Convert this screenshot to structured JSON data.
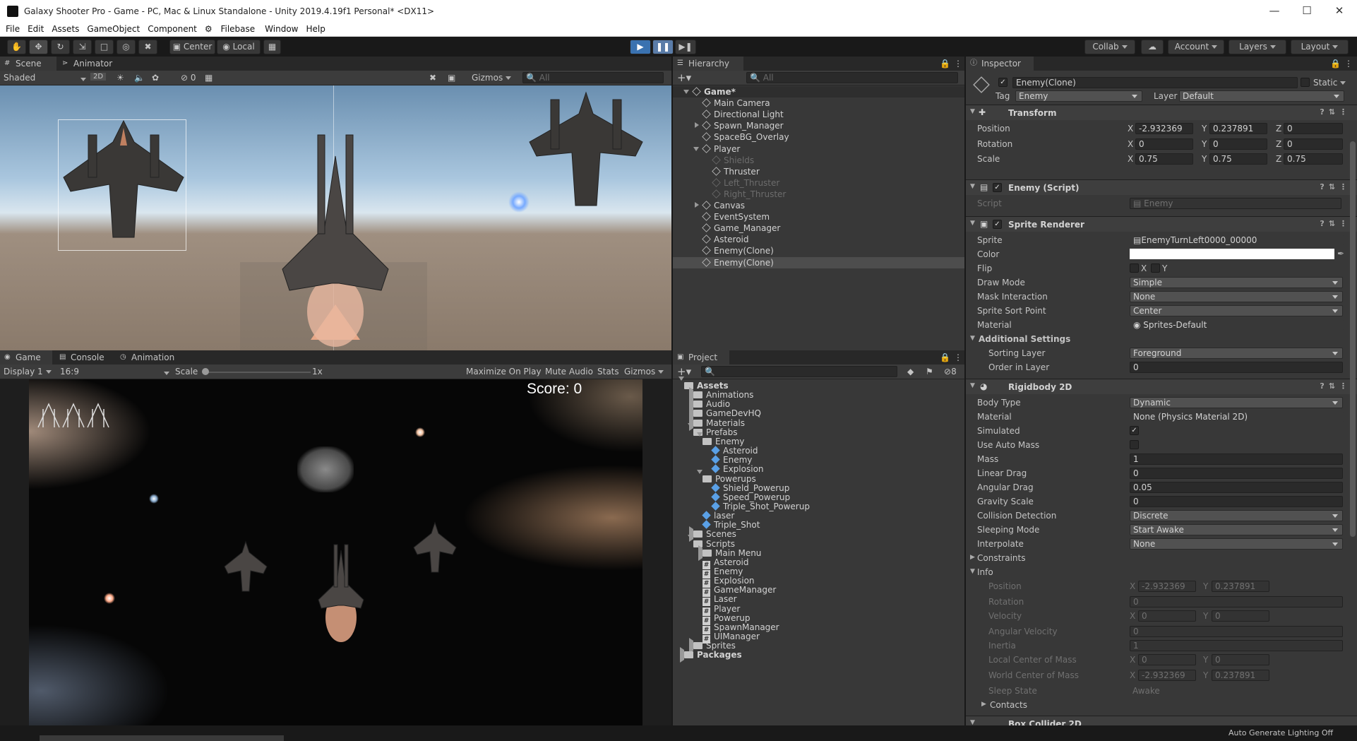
{
  "window": {
    "title": "Galaxy Shooter Pro - Game - PC, Mac & Linux Standalone - Unity 2019.4.19f1 Personal* <DX11>",
    "minimize": "—",
    "maximize": "☐",
    "close": "✕"
  },
  "menu": [
    "File",
    "Edit",
    "Assets",
    "GameObject",
    "Component",
    "Filebase",
    "Window",
    "Help"
  ],
  "toolbar": {
    "center": "Center",
    "local": "Local",
    "collab": "Collab",
    "account": "Account",
    "layers": "Layers",
    "layout": "Layout"
  },
  "scene": {
    "tab_scene": "Scene",
    "tab_animator": "Animator",
    "shading": "Shaded",
    "mode2d": "2D",
    "hidden_count": "0",
    "gizmos": "Gizmos",
    "search_placeholder": "All"
  },
  "game": {
    "tab_game": "Game",
    "tab_console": "Console",
    "tab_animation": "Animation",
    "display": "Display 1",
    "aspect": "16:9",
    "scale_label": "Scale",
    "scale_value": "1x",
    "maximize": "Maximize On Play",
    "mute": "Mute Audio",
    "stats": "Stats",
    "gizmos": "Gizmos",
    "score": "Score: 0"
  },
  "hierarchy": {
    "tab": "Hierarchy",
    "search_placeholder": "All",
    "items": [
      {
        "label": "Game*",
        "depth": 0,
        "fold": "open",
        "scene": true
      },
      {
        "label": "Main Camera",
        "depth": 1
      },
      {
        "label": "Directional Light",
        "depth": 1
      },
      {
        "label": "Spawn_Manager",
        "depth": 1,
        "fold": "closed"
      },
      {
        "label": "SpaceBG_Overlay",
        "depth": 1
      },
      {
        "label": "Player",
        "depth": 1,
        "fold": "open"
      },
      {
        "label": "Shields",
        "depth": 2,
        "disabled": true
      },
      {
        "label": "Thruster",
        "depth": 2
      },
      {
        "label": "Left_Thruster",
        "depth": 2,
        "disabled": true
      },
      {
        "label": "Right_Thruster",
        "depth": 2,
        "disabled": true
      },
      {
        "label": "Canvas",
        "depth": 1,
        "fold": "closed"
      },
      {
        "label": "EventSystem",
        "depth": 1
      },
      {
        "label": "Game_Manager",
        "depth": 1
      },
      {
        "label": "Asteroid",
        "depth": 1
      },
      {
        "label": "Enemy(Clone)",
        "depth": 1
      },
      {
        "label": "Enemy(Clone)",
        "depth": 1,
        "selected": true
      }
    ]
  },
  "project": {
    "tab": "Project",
    "hidden_count": "8",
    "items": [
      {
        "label": "Assets",
        "depth": 0,
        "type": "folder",
        "fold": "open"
      },
      {
        "label": "Animations",
        "depth": 1,
        "type": "folder",
        "fold": "closed"
      },
      {
        "label": "Audio",
        "depth": 1,
        "type": "folder",
        "fold": "closed"
      },
      {
        "label": "GameDevHQ",
        "depth": 1,
        "type": "folder",
        "fold": "closed"
      },
      {
        "label": "Materials",
        "depth": 1,
        "type": "folder",
        "fold": "closed"
      },
      {
        "label": "Prefabs",
        "depth": 1,
        "type": "folder",
        "fold": "open"
      },
      {
        "label": "Enemy",
        "depth": 2,
        "type": "folder",
        "fold": "open"
      },
      {
        "label": "Asteroid",
        "depth": 3,
        "type": "prefab"
      },
      {
        "label": "Enemy",
        "depth": 3,
        "type": "prefab"
      },
      {
        "label": "Explosion",
        "depth": 3,
        "type": "prefab"
      },
      {
        "label": "Powerups",
        "depth": 2,
        "type": "folder",
        "fold": "open"
      },
      {
        "label": "Shield_Powerup",
        "depth": 3,
        "type": "prefab"
      },
      {
        "label": "Speed_Powerup",
        "depth": 3,
        "type": "prefab"
      },
      {
        "label": "Triple_Shot_Powerup",
        "depth": 3,
        "type": "prefab"
      },
      {
        "label": "laser",
        "depth": 2,
        "type": "prefab"
      },
      {
        "label": "Triple_Shot",
        "depth": 2,
        "type": "prefab"
      },
      {
        "label": "Scenes",
        "depth": 1,
        "type": "folder",
        "fold": "closed"
      },
      {
        "label": "Scripts",
        "depth": 1,
        "type": "folder",
        "fold": "open"
      },
      {
        "label": "Main Menu",
        "depth": 2,
        "type": "folder",
        "fold": "closed"
      },
      {
        "label": "Asteroid",
        "depth": 2,
        "type": "script"
      },
      {
        "label": "Enemy",
        "depth": 2,
        "type": "script"
      },
      {
        "label": "Explosion",
        "depth": 2,
        "type": "script"
      },
      {
        "label": "GameManager",
        "depth": 2,
        "type": "script"
      },
      {
        "label": "Laser",
        "depth": 2,
        "type": "script"
      },
      {
        "label": "Player",
        "depth": 2,
        "type": "script"
      },
      {
        "label": "Powerup",
        "depth": 2,
        "type": "script"
      },
      {
        "label": "SpawnManager",
        "depth": 2,
        "type": "script"
      },
      {
        "label": "UIManager",
        "depth": 2,
        "type": "script"
      },
      {
        "label": "Sprites",
        "depth": 1,
        "type": "folder",
        "fold": "closed"
      },
      {
        "label": "Packages",
        "depth": 0,
        "type": "folder",
        "fold": "closed"
      }
    ]
  },
  "inspector": {
    "tab": "Inspector",
    "name": "Enemy(Clone)",
    "static": "Static",
    "tag_label": "Tag",
    "tag": "Enemy",
    "layer_label": "Layer",
    "layer": "Default",
    "transform": {
      "title": "Transform",
      "position": {
        "label": "Position",
        "x": "-2.932369",
        "y": "0.237891",
        "z": "0"
      },
      "rotation": {
        "label": "Rotation",
        "x": "0",
        "y": "0",
        "z": "0"
      },
      "scale": {
        "label": "Scale",
        "x": "0.75",
        "y": "0.75",
        "z": "0.75"
      }
    },
    "enemy_script": {
      "title": "Enemy (Script)",
      "script_label": "Script",
      "script": "Enemy"
    },
    "sprite_renderer": {
      "title": "Sprite Renderer",
      "sprite_label": "Sprite",
      "sprite": "EnemyTurnLeft0000_00000",
      "color_label": "Color",
      "color": "#ffffff",
      "flip_label": "Flip",
      "flip_x": "X",
      "flip_y": "Y",
      "draw_mode_label": "Draw Mode",
      "draw_mode": "Simple",
      "mask_label": "Mask Interaction",
      "mask": "None",
      "sort_point_label": "Sprite Sort Point",
      "sort_point": "Center",
      "material_label": "Material",
      "material": "Sprites-Default",
      "additional": "Additional Settings",
      "sorting_layer_label": "Sorting Layer",
      "sorting_layer": "Foreground",
      "order_label": "Order in Layer",
      "order": "0"
    },
    "rigidbody": {
      "title": "Rigidbody 2D",
      "body_type_label": "Body Type",
      "body_type": "Dynamic",
      "material_label": "Material",
      "material": "None (Physics Material 2D)",
      "simulated_label": "Simulated",
      "auto_mass_label": "Use Auto Mass",
      "mass_label": "Mass",
      "mass": "1",
      "linear_drag_label": "Linear Drag",
      "linear_drag": "0",
      "angular_drag_label": "Angular Drag",
      "angular_drag": "0.05",
      "gravity_label": "Gravity Scale",
      "gravity": "0",
      "collision_label": "Collision Detection",
      "collision": "Discrete",
      "sleeping_label": "Sleeping Mode",
      "sleeping": "Start Awake",
      "interpolate_label": "Interpolate",
      "interpolate": "None",
      "constraints": "Constraints",
      "info": "Info",
      "info_position_label": "Position",
      "info_pos_x": "-2.932369",
      "info_pos_y": "0.237891",
      "info_rotation_label": "Rotation",
      "info_rotation": "0",
      "velocity_label": "Velocity",
      "vel_x": "0",
      "vel_y": "0",
      "ang_vel_label": "Angular Velocity",
      "ang_vel": "0",
      "inertia_label": "Inertia",
      "inertia": "1",
      "local_com_label": "Local Center of Mass",
      "lcom_x": "0",
      "lcom_y": "0",
      "world_com_label": "World Center of Mass",
      "wcom_x": "-2.932369",
      "wcom_y": "0.237891",
      "sleep_state_label": "Sleep State",
      "sleep_state": "Awake",
      "contacts": "Contacts"
    },
    "box_collider": "Box Collider 2D"
  },
  "status": {
    "lighting": "Auto Generate Lighting Off"
  },
  "colors": {
    "accent": "#3a72b0",
    "panel": "#383838",
    "selected": "#4d4d4d"
  }
}
